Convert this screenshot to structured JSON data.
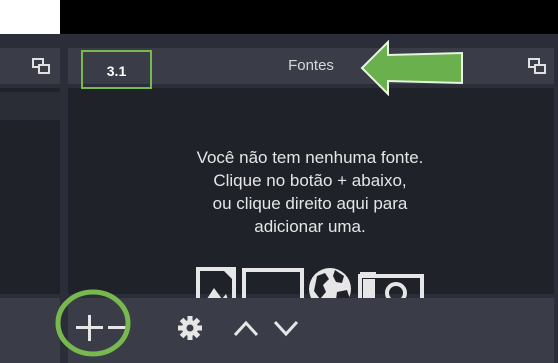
{
  "colors": {
    "panel_bg": "#2b2e38",
    "list_bg": "#1f2229",
    "header_bg": "#3a3d48",
    "annotation_green": "#77b84f",
    "arrow_green": "#6ab04c"
  },
  "sources_panel": {
    "title": "Fontes",
    "empty_message": {
      "line1": "Você não tem nenhuma fonte.",
      "line2": "Clique no botão + abaixo,",
      "line3": "ou clique direito aqui para",
      "line4": "adicionar uma."
    },
    "empty_icons": [
      "image-icon",
      "monitor-icon",
      "globe-icon",
      "camera-icon"
    ],
    "toolbar": [
      "add-icon",
      "remove-icon",
      "gear-icon",
      "chevron-up-icon",
      "chevron-down-icon"
    ]
  },
  "annotation": {
    "label": "3.1"
  }
}
